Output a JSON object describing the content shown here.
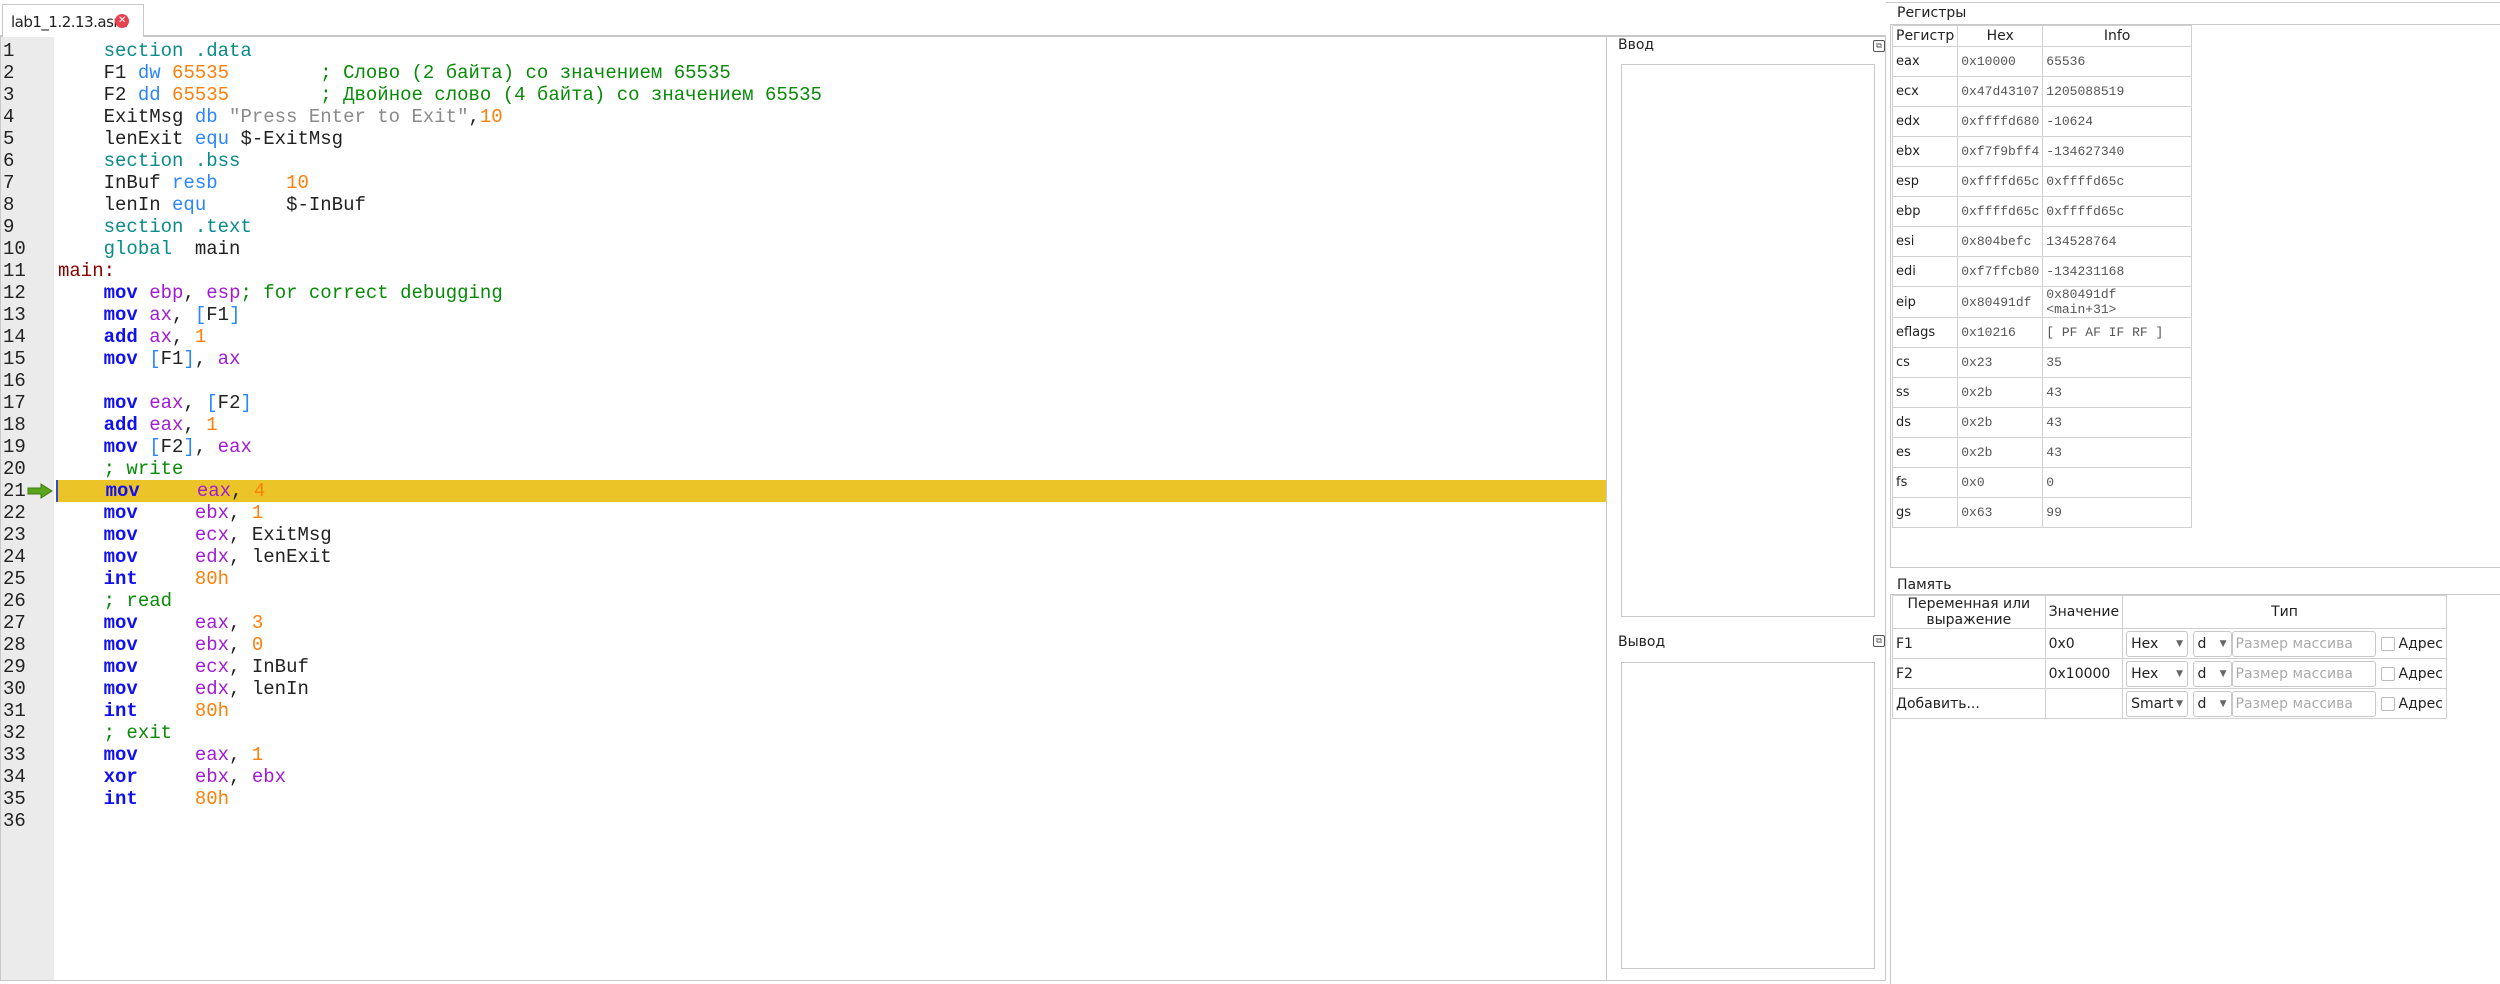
{
  "tab": {
    "title": "lab1_1.2.13.asm",
    "close_icon": "close-icon"
  },
  "editor": {
    "current_line": 21,
    "highlight_color": "#ebc527",
    "lines": [
      [
        [
          "p",
          "    "
        ],
        [
          "kw",
          "section .data"
        ]
      ],
      [
        [
          "p",
          "    F1 "
        ],
        [
          "dir",
          "dw"
        ],
        [
          "p",
          " "
        ],
        [
          "num",
          "65535"
        ],
        [
          "p",
          "        "
        ],
        [
          "cmt",
          "; Слово (2 байта) со значением 65535"
        ]
      ],
      [
        [
          "p",
          "    F2 "
        ],
        [
          "dir",
          "dd"
        ],
        [
          "p",
          " "
        ],
        [
          "num",
          "65535"
        ],
        [
          "p",
          "        "
        ],
        [
          "cmt",
          "; Двойное слово (4 байта) со значением 65535"
        ]
      ],
      [
        [
          "p",
          "    ExitMsg "
        ],
        [
          "dir",
          "db"
        ],
        [
          "p",
          " "
        ],
        [
          "str",
          "\"Press Enter to Exit\""
        ],
        [
          "p",
          ","
        ],
        [
          "num",
          "10"
        ]
      ],
      [
        [
          "p",
          "    lenExit "
        ],
        [
          "dir",
          "equ"
        ],
        [
          "p",
          " $-ExitMsg"
        ]
      ],
      [
        [
          "p",
          "    "
        ],
        [
          "kw",
          "section .bss"
        ]
      ],
      [
        [
          "p",
          "    InBuf "
        ],
        [
          "dir",
          "resb"
        ],
        [
          "p",
          "      "
        ],
        [
          "num",
          "10"
        ]
      ],
      [
        [
          "p",
          "    lenIn "
        ],
        [
          "dir",
          "equ"
        ],
        [
          "p",
          "       $-InBuf"
        ]
      ],
      [
        [
          "p",
          "    "
        ],
        [
          "kw",
          "section .text"
        ]
      ],
      [
        [
          "p",
          "    "
        ],
        [
          "kw",
          "global"
        ],
        [
          "p",
          "  main"
        ]
      ],
      [
        [
          "lbl",
          "main:"
        ]
      ],
      [
        [
          "p",
          "    "
        ],
        [
          "ins",
          "mov"
        ],
        [
          "p",
          " "
        ],
        [
          "reg",
          "ebp"
        ],
        [
          "p",
          ", "
        ],
        [
          "reg",
          "esp"
        ],
        [
          "cmt",
          "; for correct debugging"
        ]
      ],
      [
        [
          "p",
          "    "
        ],
        [
          "ins",
          "mov"
        ],
        [
          "p",
          " "
        ],
        [
          "reg",
          "ax"
        ],
        [
          "p",
          ", "
        ],
        [
          "br",
          "["
        ],
        [
          "p",
          "F1"
        ],
        [
          "br",
          "]"
        ]
      ],
      [
        [
          "p",
          "    "
        ],
        [
          "ins",
          "add"
        ],
        [
          "p",
          " "
        ],
        [
          "reg",
          "ax"
        ],
        [
          "p",
          ", "
        ],
        [
          "num",
          "1"
        ]
      ],
      [
        [
          "p",
          "    "
        ],
        [
          "ins",
          "mov"
        ],
        [
          "p",
          " "
        ],
        [
          "br",
          "["
        ],
        [
          "p",
          "F1"
        ],
        [
          "br",
          "]"
        ],
        [
          "p",
          ", "
        ],
        [
          "reg",
          "ax"
        ]
      ],
      [],
      [
        [
          "p",
          "    "
        ],
        [
          "ins",
          "mov"
        ],
        [
          "p",
          " "
        ],
        [
          "reg",
          "eax"
        ],
        [
          "p",
          ", "
        ],
        [
          "br",
          "["
        ],
        [
          "p",
          "F2"
        ],
        [
          "br",
          "]"
        ]
      ],
      [
        [
          "p",
          "    "
        ],
        [
          "ins",
          "add"
        ],
        [
          "p",
          " "
        ],
        [
          "reg",
          "eax"
        ],
        [
          "p",
          ", "
        ],
        [
          "num",
          "1"
        ]
      ],
      [
        [
          "p",
          "    "
        ],
        [
          "ins",
          "mov"
        ],
        [
          "p",
          " "
        ],
        [
          "br",
          "["
        ],
        [
          "p",
          "F2"
        ],
        [
          "br",
          "]"
        ],
        [
          "p",
          ", "
        ],
        [
          "reg",
          "eax"
        ]
      ],
      [
        [
          "p",
          "    "
        ],
        [
          "cmt",
          "; write"
        ]
      ],
      [
        [
          "p",
          "    "
        ],
        [
          "ins",
          "mov"
        ],
        [
          "p",
          "     "
        ],
        [
          "reg",
          "eax"
        ],
        [
          "p",
          ", "
        ],
        [
          "num",
          "4"
        ]
      ],
      [
        [
          "p",
          "    "
        ],
        [
          "ins",
          "mov"
        ],
        [
          "p",
          "     "
        ],
        [
          "reg",
          "ebx"
        ],
        [
          "p",
          ", "
        ],
        [
          "num",
          "1"
        ]
      ],
      [
        [
          "p",
          "    "
        ],
        [
          "ins",
          "mov"
        ],
        [
          "p",
          "     "
        ],
        [
          "reg",
          "ecx"
        ],
        [
          "p",
          ", ExitMsg"
        ]
      ],
      [
        [
          "p",
          "    "
        ],
        [
          "ins",
          "mov"
        ],
        [
          "p",
          "     "
        ],
        [
          "reg",
          "edx"
        ],
        [
          "p",
          ", lenExit"
        ]
      ],
      [
        [
          "p",
          "    "
        ],
        [
          "ins",
          "int"
        ],
        [
          "p",
          "     "
        ],
        [
          "num",
          "80h"
        ]
      ],
      [
        [
          "p",
          "    "
        ],
        [
          "cmt",
          "; read"
        ]
      ],
      [
        [
          "p",
          "    "
        ],
        [
          "ins",
          "mov"
        ],
        [
          "p",
          "     "
        ],
        [
          "reg",
          "eax"
        ],
        [
          "p",
          ", "
        ],
        [
          "num",
          "3"
        ]
      ],
      [
        [
          "p",
          "    "
        ],
        [
          "ins",
          "mov"
        ],
        [
          "p",
          "     "
        ],
        [
          "reg",
          "ebx"
        ],
        [
          "p",
          ", "
        ],
        [
          "num",
          "0"
        ]
      ],
      [
        [
          "p",
          "    "
        ],
        [
          "ins",
          "mov"
        ],
        [
          "p",
          "     "
        ],
        [
          "reg",
          "ecx"
        ],
        [
          "p",
          ", InBuf"
        ]
      ],
      [
        [
          "p",
          "    "
        ],
        [
          "ins",
          "mov"
        ],
        [
          "p",
          "     "
        ],
        [
          "reg",
          "edx"
        ],
        [
          "p",
          ", lenIn"
        ]
      ],
      [
        [
          "p",
          "    "
        ],
        [
          "ins",
          "int"
        ],
        [
          "p",
          "     "
        ],
        [
          "num",
          "80h"
        ]
      ],
      [
        [
          "p",
          "    "
        ],
        [
          "cmt",
          "; exit"
        ]
      ],
      [
        [
          "p",
          "    "
        ],
        [
          "ins",
          "mov"
        ],
        [
          "p",
          "     "
        ],
        [
          "reg",
          "eax"
        ],
        [
          "p",
          ", "
        ],
        [
          "num",
          "1"
        ]
      ],
      [
        [
          "p",
          "    "
        ],
        [
          "ins",
          "xor"
        ],
        [
          "p",
          "     "
        ],
        [
          "reg",
          "ebx"
        ],
        [
          "p",
          ", "
        ],
        [
          "reg",
          "ebx"
        ]
      ],
      [
        [
          "p",
          "    "
        ],
        [
          "ins",
          "int"
        ],
        [
          "p",
          "     "
        ],
        [
          "num",
          "80h"
        ]
      ],
      []
    ]
  },
  "io": {
    "input_label": "Ввод",
    "output_label": "Вывод"
  },
  "registers": {
    "title": "Регистры",
    "headers": [
      "Регистр",
      "Hex",
      "Info"
    ],
    "rows": [
      [
        "eax",
        "0x10000",
        "65536"
      ],
      [
        "ecx",
        "0x47d43107",
        "1205088519"
      ],
      [
        "edx",
        "0xffffd680",
        "-10624"
      ],
      [
        "ebx",
        "0xf7f9bff4",
        "-134627340"
      ],
      [
        "esp",
        "0xffffd65c",
        "0xffffd65c"
      ],
      [
        "ebp",
        "0xffffd65c",
        "0xffffd65c"
      ],
      [
        "esi",
        "0x804befc",
        "134528764"
      ],
      [
        "edi",
        "0xf7ffcb80",
        "-134231168"
      ],
      [
        "eip",
        "0x80491df",
        "0x80491df <main+31>"
      ],
      [
        "eflags",
        "0x10216",
        "[ PF AF IF RF ]"
      ],
      [
        "cs",
        "0x23",
        "35"
      ],
      [
        "ss",
        "0x2b",
        "43"
      ],
      [
        "ds",
        "0x2b",
        "43"
      ],
      [
        "es",
        "0x2b",
        "43"
      ],
      [
        "fs",
        "0x0",
        "0"
      ],
      [
        "gs",
        "0x63",
        "99"
      ]
    ]
  },
  "memory": {
    "title": "Память",
    "headers": [
      "Переменная или выражение",
      "Значение",
      "Тип"
    ],
    "rows": [
      {
        "name": "F1",
        "value": "0x0",
        "format": "Hex",
        "size": "d",
        "array_placeholder": "Размер массива",
        "address_label": "Адрес"
      },
      {
        "name": "F2",
        "value": "0x10000",
        "format": "Hex",
        "size": "d",
        "array_placeholder": "Размер массива",
        "address_label": "Адрес"
      },
      {
        "name": "Добавить...",
        "value": "",
        "format": "Smart",
        "size": "d",
        "array_placeholder": "Размер массива",
        "address_label": "Адрес"
      }
    ]
  }
}
